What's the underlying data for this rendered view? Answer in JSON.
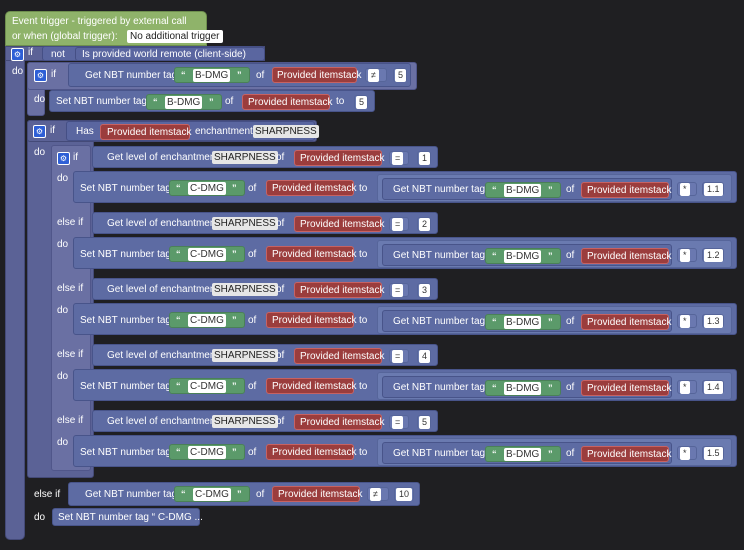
{
  "trigger": {
    "title": "Event trigger - triggered by external call",
    "global_prefix": "or when (global trigger):",
    "global_value": "No additional trigger"
  },
  "kw": {
    "if": "if",
    "do": "do",
    "else_if": "else if",
    "not": "not",
    "of": "of",
    "to": "to",
    "has": "Has",
    "enchantment": "enchantment",
    "open_quote": "“",
    "close_quote": "”"
  },
  "remote_text": "Is provided world remote (client-side)",
  "get_nbt": "Get NBT number tag",
  "set_nbt": "Set NBT number tag",
  "provided_item": "Provided itemstack",
  "get_level": "Get level of enchantment",
  "sharpness": "SHARPNESS",
  "b_dmg": "B-DMG",
  "c_dmg": "C-DMG",
  "ops": {
    "neq": "≠",
    "eq": "=",
    "mul": "*"
  },
  "vals": {
    "five": "5",
    "ten": "10",
    "levels": [
      "1",
      "2",
      "3",
      "4",
      "5"
    ],
    "mults": [
      "1.1",
      "1.2",
      "1.3",
      "1.4",
      "1.5"
    ]
  },
  "collapsed_text": "Set NBT number tag “ C-DMG ..."
}
